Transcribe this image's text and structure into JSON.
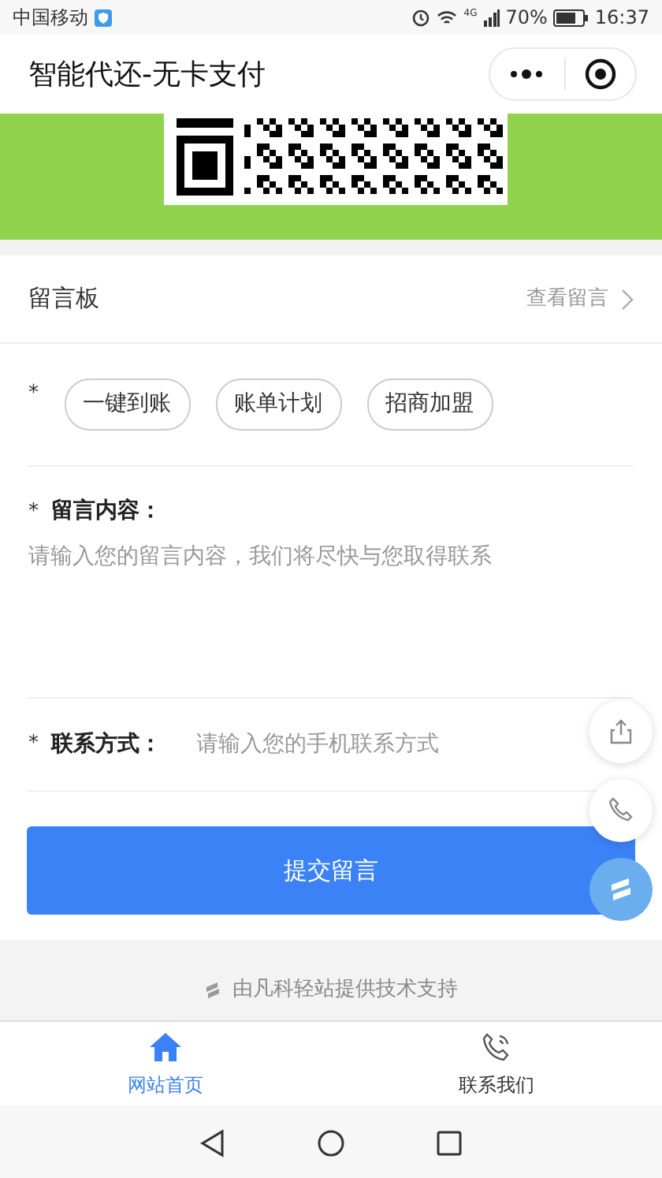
{
  "status_bar": {
    "carrier": "中国移动",
    "signal_label": "4G",
    "battery": "70%",
    "time": "16:37"
  },
  "header": {
    "title": "智能代还-无卡支付"
  },
  "board": {
    "title": "留言板",
    "link": "查看留言"
  },
  "topics": {
    "required_mark": "*",
    "tags": [
      {
        "label": "一键到账",
        "selected": false
      },
      {
        "label": "账单计划",
        "selected": false
      },
      {
        "label": "招商加盟",
        "selected": false
      }
    ]
  },
  "message": {
    "required_mark": "*",
    "label": "留言内容：",
    "placeholder": "请输入您的留言内容，我们将尽快与您取得联系"
  },
  "contact": {
    "required_mark": "*",
    "label": "联系方式：",
    "placeholder": "请输入您的手机联系方式"
  },
  "submit": "提交留言",
  "footer": "由凡科轻站提供技术支持",
  "tabs": [
    {
      "label": "网站首页",
      "selected": true
    },
    {
      "label": "联系我们",
      "selected": false
    }
  ]
}
